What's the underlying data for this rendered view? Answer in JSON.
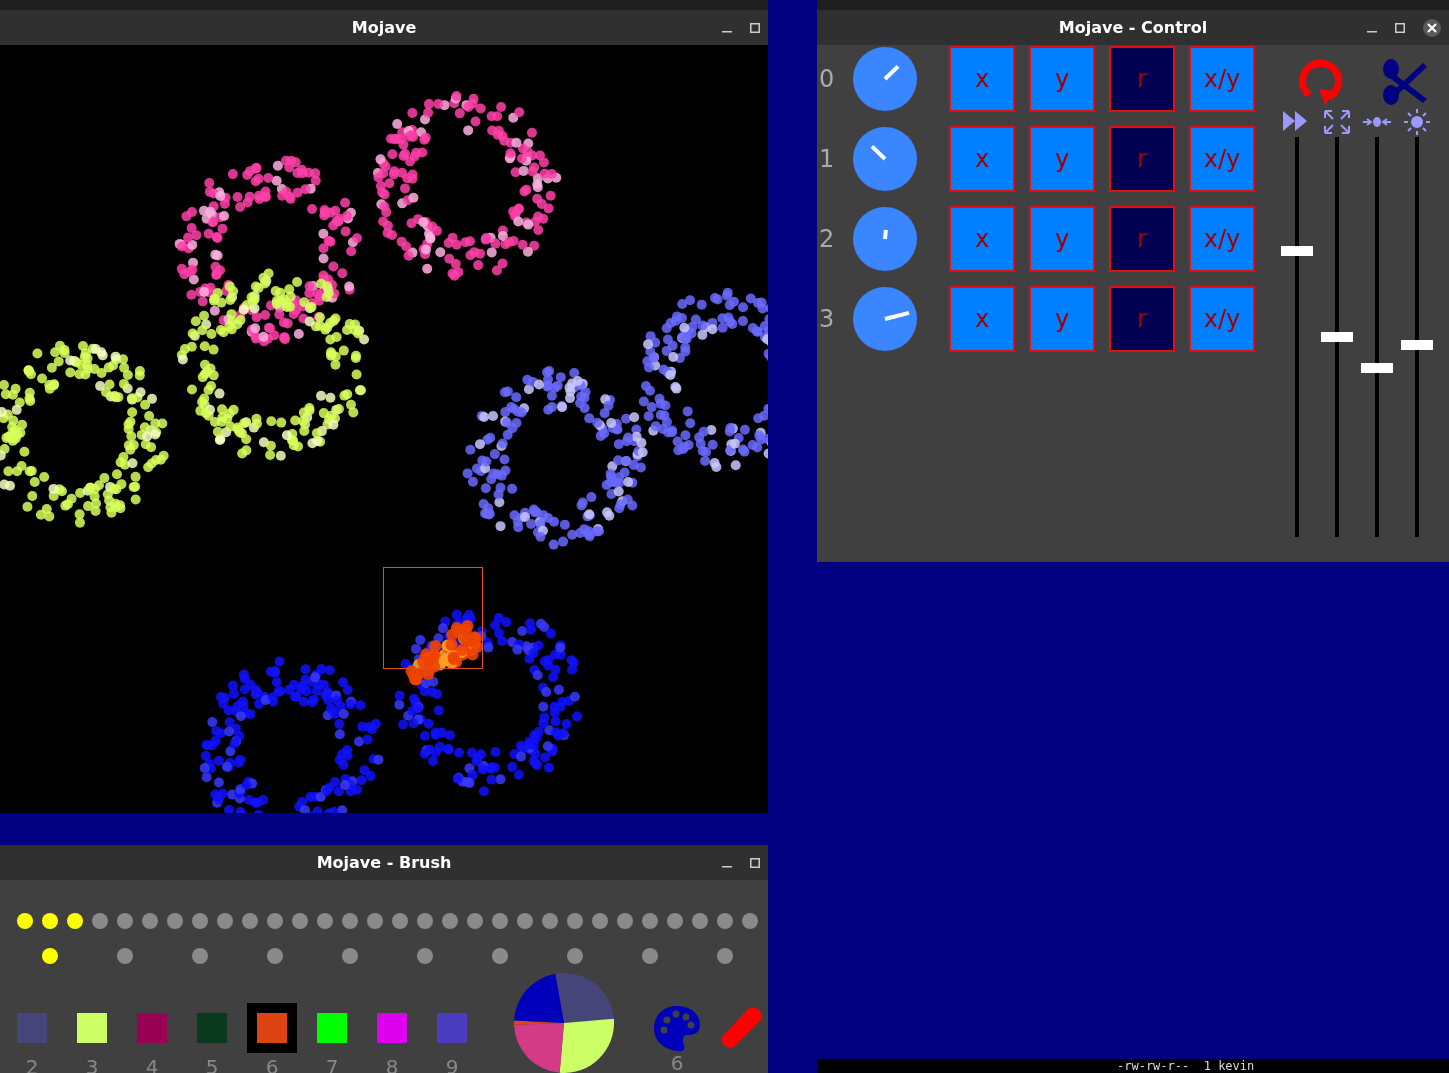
{
  "main_window": {
    "title": "Mojave"
  },
  "control_window": {
    "title": "Mojave - Control",
    "rows": [
      {
        "label": "0",
        "knob": {
          "level": 0.67
        },
        "buttons": [
          {
            "label": "x",
            "selected": false
          },
          {
            "label": "y",
            "selected": false
          },
          {
            "label": "r",
            "selected": true
          },
          {
            "label": "x/y",
            "selected": false
          }
        ]
      },
      {
        "label": "1",
        "knob": {
          "level": 0.33
        },
        "buttons": [
          {
            "label": "x",
            "selected": false
          },
          {
            "label": "y",
            "selected": false
          },
          {
            "label": "r",
            "selected": true
          },
          {
            "label": "x/y",
            "selected": false
          }
        ]
      },
      {
        "label": "2",
        "knob": {
          "level": 0.52
        },
        "buttons": [
          {
            "label": "x",
            "selected": false
          },
          {
            "label": "y",
            "selected": false
          },
          {
            "label": "r",
            "selected": true
          },
          {
            "label": "x/y",
            "selected": false
          }
        ]
      },
      {
        "label": "3",
        "knob": {
          "level": 0.78
        },
        "buttons": [
          {
            "label": "x",
            "selected": false
          },
          {
            "label": "y",
            "selected": false
          },
          {
            "label": "r",
            "selected": true
          },
          {
            "label": "x/y",
            "selected": false
          }
        ]
      }
    ],
    "sliders": [
      {
        "kind": "speed",
        "level": 0.72
      },
      {
        "kind": "expand",
        "level": 0.5
      },
      {
        "kind": "contract",
        "level": 0.42
      },
      {
        "kind": "brightness",
        "level": 0.48
      }
    ]
  },
  "brush_window": {
    "title": "Mojave - Brush",
    "size_dots": [
      {
        "on": true
      },
      {
        "on": true
      },
      {
        "on": true
      },
      {
        "on": false
      },
      {
        "on": false
      },
      {
        "on": false
      },
      {
        "on": false
      },
      {
        "on": false
      },
      {
        "on": false
      },
      {
        "on": false
      },
      {
        "on": false
      },
      {
        "on": false
      },
      {
        "on": false
      },
      {
        "on": false
      },
      {
        "on": false
      },
      {
        "on": false
      },
      {
        "on": false
      },
      {
        "on": false
      },
      {
        "on": false
      },
      {
        "on": false
      },
      {
        "on": false
      },
      {
        "on": false
      },
      {
        "on": false
      },
      {
        "on": false
      },
      {
        "on": false
      },
      {
        "on": false
      },
      {
        "on": false
      },
      {
        "on": false
      },
      {
        "on": false
      },
      {
        "on": false
      }
    ],
    "spacing_dots": [
      {
        "on": true
      },
      {
        "on": false
      },
      {
        "on": false
      },
      {
        "on": false
      },
      {
        "on": false
      },
      {
        "on": false
      },
      {
        "on": false
      },
      {
        "on": false
      },
      {
        "on": false
      },
      {
        "on": false
      }
    ],
    "swatches": [
      {
        "label": "2",
        "color": "#45457a",
        "selected": false
      },
      {
        "label": "3",
        "color": "#ccff66",
        "selected": false
      },
      {
        "label": "4",
        "color": "#990055",
        "selected": false
      },
      {
        "label": "5",
        "color": "#0a3a1e",
        "selected": false
      },
      {
        "label": "6",
        "color": "#dd4411",
        "selected": true
      },
      {
        "label": "7",
        "color": "#00ff00",
        "selected": false
      },
      {
        "label": "8",
        "color": "#dd00ee",
        "selected": false
      },
      {
        "label": "9",
        "color": "#4c3cbf",
        "selected": false
      }
    ],
    "palette_label": "6"
  },
  "terminal": {
    "text": "-rw-rw-r--  1 kevin"
  }
}
